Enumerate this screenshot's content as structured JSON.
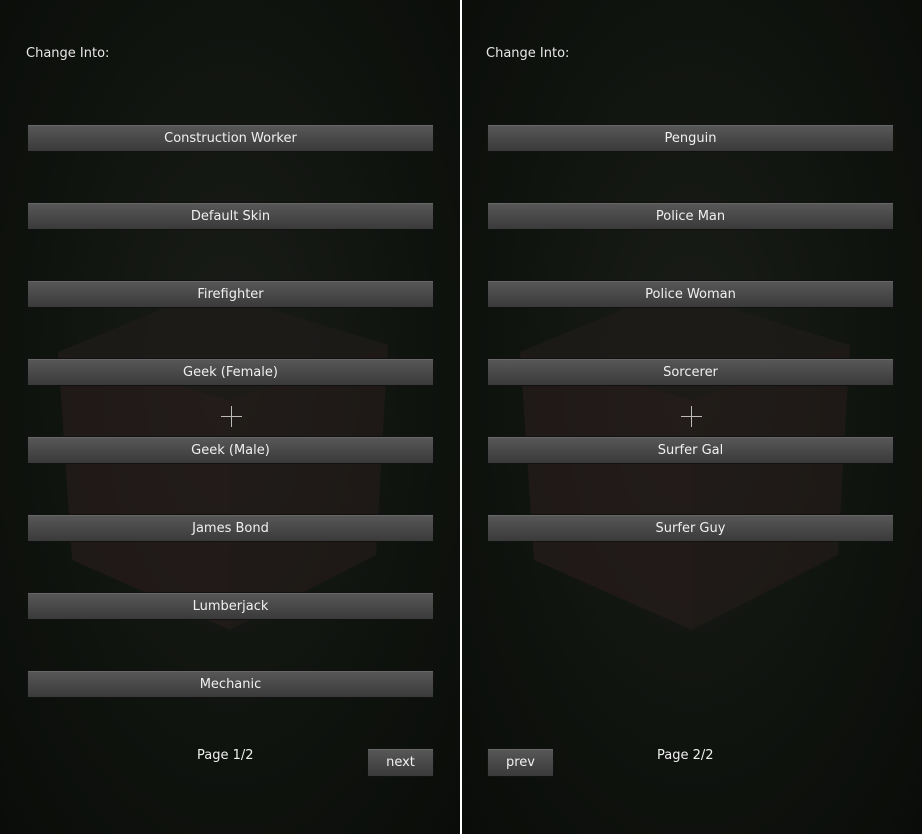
{
  "panels": [
    {
      "title": "Change Into:",
      "skins": [
        "Construction Worker",
        "Default Skin",
        "Firefighter",
        "Geek (Female)",
        "Geek (Male)",
        "James Bond",
        "Lumberjack",
        "Mechanic"
      ],
      "page": "Page 1/2",
      "nav_label": "next"
    },
    {
      "title": "Change Into:",
      "skins": [
        "Penguin",
        "Police Man",
        "Police Woman",
        "Sorcerer",
        "Surfer Gal",
        "Surfer Guy"
      ],
      "page": "Page 2/2",
      "nav_label": "prev"
    }
  ]
}
